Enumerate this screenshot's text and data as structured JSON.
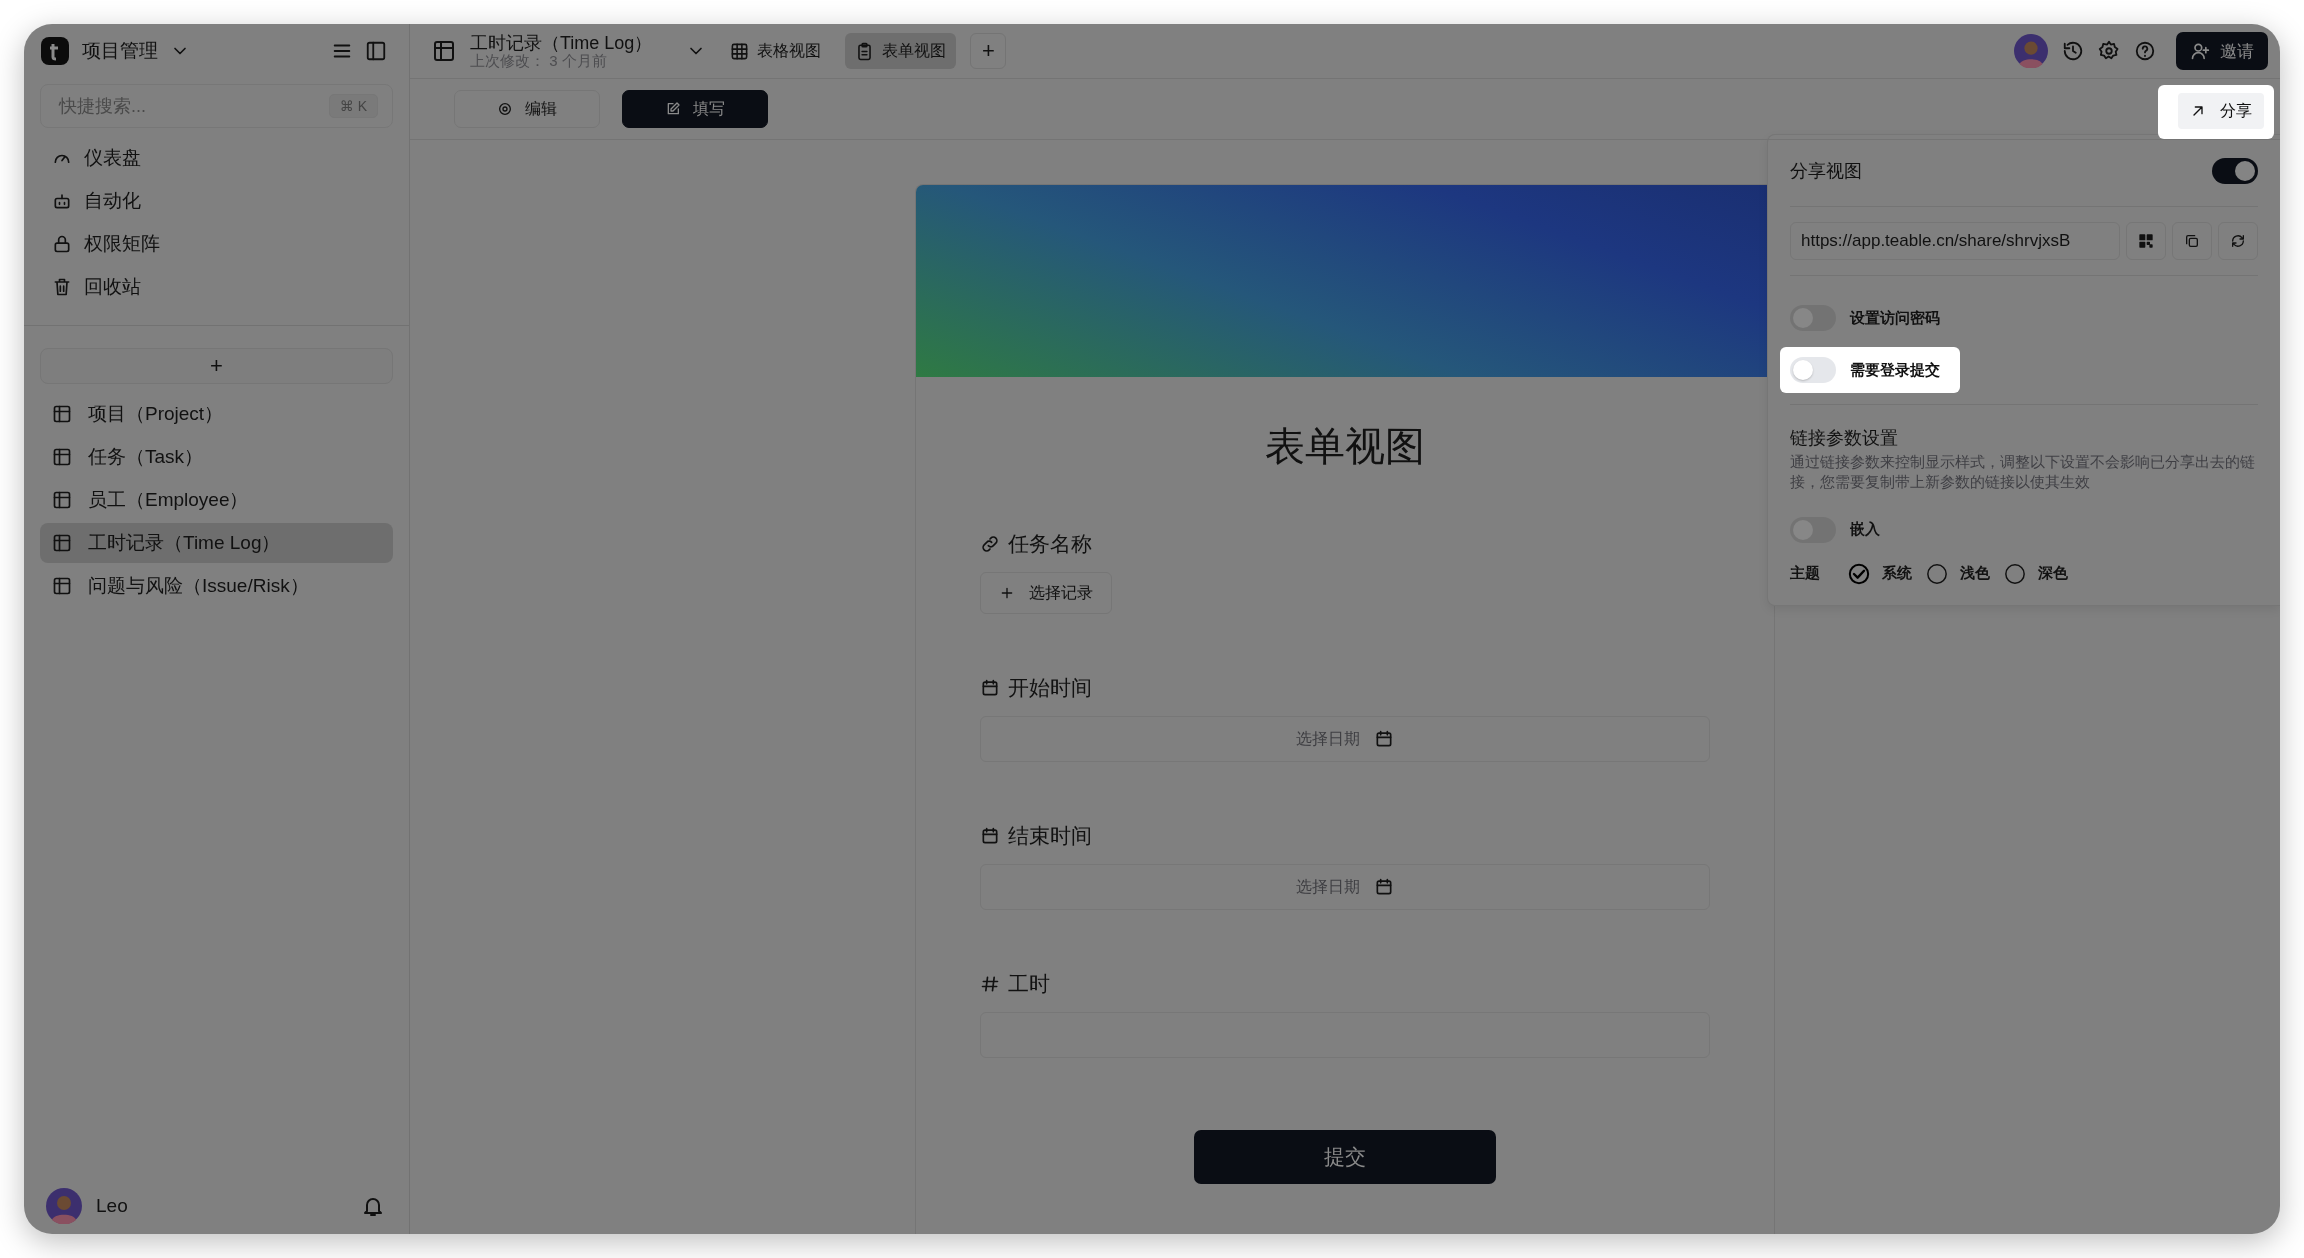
{
  "workspace": {
    "name": "项目管理"
  },
  "search": {
    "placeholder": "快捷搜索...",
    "shortcut": "⌘ K"
  },
  "nav": [
    {
      "label": "仪表盘",
      "kind": "dashboard"
    },
    {
      "label": "自动化",
      "kind": "automation"
    },
    {
      "label": "权限矩阵",
      "kind": "permission"
    },
    {
      "label": "回收站",
      "kind": "trash"
    }
  ],
  "add_table": "+",
  "tables": [
    {
      "label": "项目（Project）",
      "selected": false
    },
    {
      "label": "任务（Task）",
      "selected": false
    },
    {
      "label": "员工（Employee）",
      "selected": false
    },
    {
      "label": "工时记录（Time Log）",
      "selected": true
    },
    {
      "label": "问题与风险（Issue/Risk）",
      "selected": false
    }
  ],
  "user": {
    "name": "Leo"
  },
  "table_header": {
    "title": "工时记录（Time Log）",
    "subtitle": "上次修改： 3 个月前"
  },
  "views": [
    {
      "label": "表格视图",
      "kind": "grid",
      "selected": false
    },
    {
      "label": "表单视图",
      "kind": "form",
      "selected": true
    }
  ],
  "add_view": "+",
  "invite_button": "邀请",
  "modes": [
    {
      "label": "编辑",
      "kind": "edit",
      "selected": false
    },
    {
      "label": "填写",
      "kind": "fill",
      "selected": true
    }
  ],
  "share_button": {
    "label": "分享",
    "highlighted": true
  },
  "share_panel": {
    "title": "分享视图",
    "on": true,
    "url": "https://app.teable.cn/share/shrvjxsB",
    "options": [
      {
        "label": "设置访问密码",
        "on": false,
        "highlighted": false
      },
      {
        "label": "需要登录提交",
        "on": false,
        "highlighted": true
      }
    ],
    "params_title": "链接参数设置",
    "params_hint": "通过链接参数来控制显示样式，调整以下设置不会影响已分享出去的链接，您需要复制带上新参数的链接以使其生效",
    "embed": {
      "label": "嵌入",
      "on": false
    },
    "theme": {
      "label": "主题",
      "options": [
        {
          "label": "系统",
          "selected": true
        },
        {
          "label": "浅色",
          "selected": false
        },
        {
          "label": "深色",
          "selected": false
        }
      ]
    }
  },
  "form": {
    "title": "表单视图",
    "fields": [
      {
        "label": "任务名称",
        "kind": "link",
        "button": "选择记录"
      },
      {
        "label": "开始时间",
        "kind": "date",
        "placeholder": "选择日期"
      },
      {
        "label": "结束时间",
        "kind": "date",
        "placeholder": "选择日期"
      },
      {
        "label": "工时",
        "kind": "number"
      }
    ],
    "submit": "提交"
  }
}
